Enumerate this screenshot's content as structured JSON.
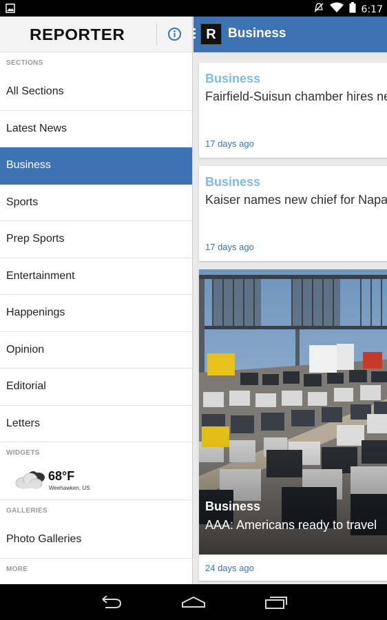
{
  "status_bar": {
    "time": "6:17",
    "icons": [
      "image-icon",
      "mute-icon",
      "wifi-icon",
      "battery-icon"
    ]
  },
  "drawer": {
    "logo": "REPORTER",
    "sections_header": "SECTIONS",
    "items": [
      {
        "label": "All Sections",
        "active": false
      },
      {
        "label": "Latest News",
        "active": false
      },
      {
        "label": "Business",
        "active": true
      },
      {
        "label": "Sports",
        "active": false
      },
      {
        "label": "Prep Sports",
        "active": false
      },
      {
        "label": "Entertainment",
        "active": false
      },
      {
        "label": "Happenings",
        "active": false
      },
      {
        "label": "Opinion",
        "active": false
      },
      {
        "label": "Editorial",
        "active": false
      },
      {
        "label": "Letters",
        "active": false
      }
    ],
    "widgets_header": "WIDGETS",
    "weather": {
      "temp": "68°F",
      "location": "Weehawken, US"
    },
    "galleries_header": "GALLERIES",
    "galleries_item": "Photo Galleries",
    "more_header": "MORE"
  },
  "app_bar": {
    "logo_letter": "R",
    "title": "Business"
  },
  "articles": [
    {
      "category": "Business",
      "headline": "Fairfield-Suisun chamber hires new",
      "time": "17 days ago"
    },
    {
      "category": "Business",
      "headline": "Kaiser names new chief for Napa",
      "time": "17 days ago"
    },
    {
      "category": "Business",
      "headline": "AAA: Americans ready to travel",
      "time": "24 days ago"
    }
  ],
  "colors": {
    "accent": "#3d73b3",
    "category_light": "#7fbbea"
  }
}
